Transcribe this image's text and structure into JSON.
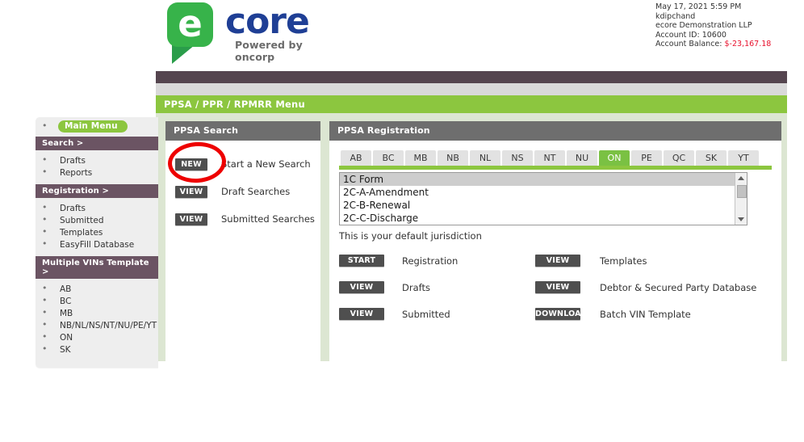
{
  "header": {
    "logo": {
      "mark_letter": "e",
      "wordmark": "core",
      "tagline": "Powered by oncorp"
    },
    "account": {
      "timestamp": "May 17, 2021 5:59 PM",
      "username": "kdipchand",
      "organization": "ecore Demonstration LLP",
      "account_id": "Account ID: 10600",
      "balance_label": "Account Balance:",
      "balance_value": "$-23,167.18"
    }
  },
  "menu_bar": {
    "title": "PPSA / PPR / RPMRR Menu"
  },
  "sidebar": {
    "main_menu": "Main Menu",
    "sections": [
      {
        "title": "Search >",
        "items": [
          "Drafts",
          "Reports"
        ]
      },
      {
        "title": "Registration >",
        "items": [
          "Drafts",
          "Submitted",
          "Templates",
          "EasyFill Database"
        ]
      },
      {
        "title": "Multiple VINs Template >",
        "items": [
          "AB",
          "BC",
          "MB",
          "NB/NL/NS/NT/NU/PE/YT",
          "ON",
          "SK"
        ]
      }
    ]
  },
  "search_panel": {
    "title": "PPSA Search",
    "rows": [
      {
        "button": "NEW",
        "label": "Start a New Search"
      },
      {
        "button": "VIEW",
        "label": "Draft Searches"
      },
      {
        "button": "VIEW",
        "label": "Submitted Searches"
      }
    ]
  },
  "registration_panel": {
    "title": "PPSA Registration",
    "tabs": [
      "AB",
      "BC",
      "MB",
      "NB",
      "NL",
      "NS",
      "NT",
      "NU",
      "ON",
      "PE",
      "QC",
      "SK",
      "YT"
    ],
    "active_tab": "ON",
    "form_options": [
      "1C Form",
      "2C-A-Amendment",
      "2C-B-Renewal",
      "2C-C-Discharge"
    ],
    "selected_option": "1C Form",
    "default_jurisdiction_note": "This is your default jurisdiction",
    "actions": [
      {
        "button": "START",
        "label": "Registration"
      },
      {
        "button": "VIEW",
        "label": "Templates"
      },
      {
        "button": "VIEW",
        "label": "Drafts"
      },
      {
        "button": "VIEW",
        "label": "Debtor & Secured Party Database"
      },
      {
        "button": "VIEW",
        "label": "Submitted"
      },
      {
        "button": "DOWNLOAD",
        "label": "Batch VIN Template"
      }
    ]
  },
  "annotation": {
    "shape": "red-circle-highlight",
    "target": "NEW",
    "color": "#ee0000"
  }
}
